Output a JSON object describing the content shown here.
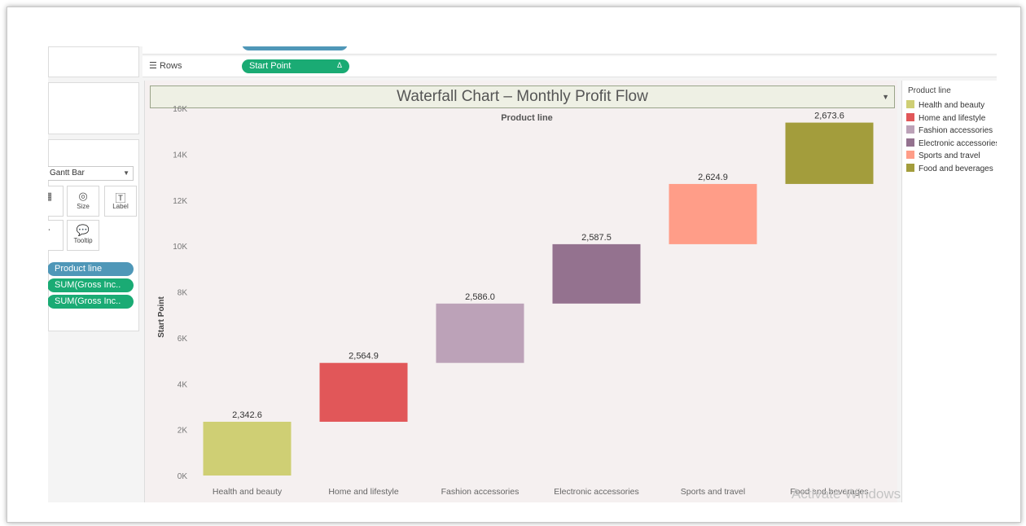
{
  "shelves": {
    "rows_label": "Rows",
    "rows_pill": "Start Point"
  },
  "marks": {
    "type": "Gantt Bar",
    "size_label": "Size",
    "label_label": "Label",
    "tooltip_label": "Tooltip",
    "pills": [
      "Product line",
      "SUM(Gross Inc..",
      "SUM(Gross Inc.."
    ]
  },
  "legend": {
    "title": "Product line",
    "items": [
      {
        "label": "Health and beauty",
        "color": "#cfcf74"
      },
      {
        "label": "Home and lifestyle",
        "color": "#e15759"
      },
      {
        "label": "Fashion accessories",
        "color": "#bca2b8"
      },
      {
        "label": "Electronic accessories",
        "color": "#94728f"
      },
      {
        "label": "Sports and travel",
        "color": "#ff9d88"
      },
      {
        "label": "Food and beverages",
        "color": "#a39d3c"
      }
    ]
  },
  "watermark": "Activate Windows",
  "chart_data": {
    "type": "bar",
    "subtype": "waterfall-gantt",
    "title": "Waterfall Chart – Monthly Profit Flow",
    "column_header": "Product line",
    "ylabel": "Start Point",
    "xlabel": "",
    "ylim": [
      0,
      16500
    ],
    "y_ticks": [
      0,
      2000,
      4000,
      6000,
      8000,
      10000,
      12000,
      14000,
      16000
    ],
    "y_tick_labels": [
      "0K",
      "2K",
      "4K",
      "6K",
      "8K",
      "10K",
      "12K",
      "14K",
      "16K"
    ],
    "categories": [
      "Health and beauty",
      "Home and lifestyle",
      "Fashion accessories",
      "Electronic accessories",
      "Sports and travel",
      "Food and beverages"
    ],
    "values": [
      2342.6,
      2564.9,
      2586.0,
      2587.5,
      2624.9,
      2673.6
    ],
    "value_labels": [
      "2,342.6",
      "2,564.9",
      "2,586.0",
      "2,587.5",
      "2,624.9",
      "2,673.6"
    ],
    "colors": [
      "#cfcf74",
      "#e15759",
      "#bca2b8",
      "#94728f",
      "#ff9d88",
      "#a39d3c"
    ],
    "grid": false
  }
}
